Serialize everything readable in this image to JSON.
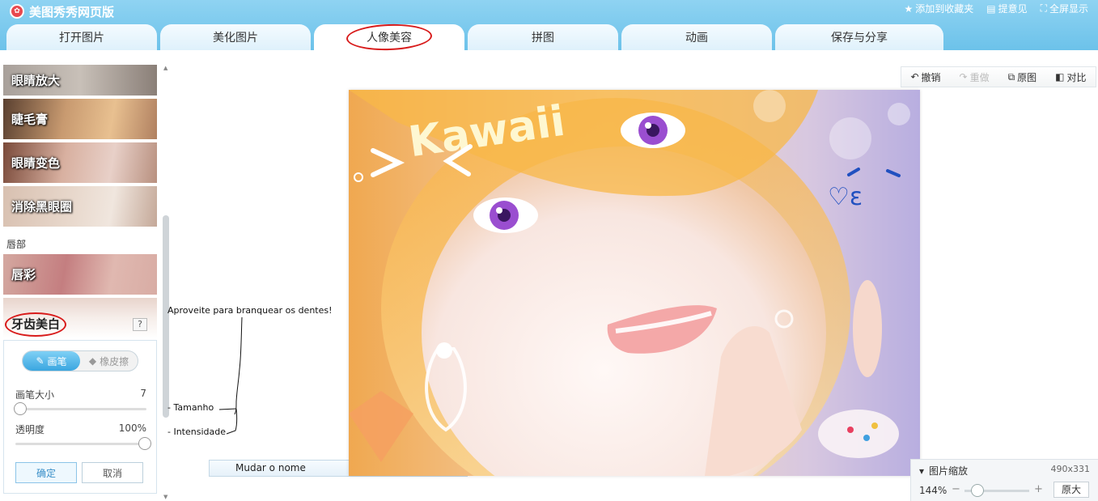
{
  "app": {
    "title": "美图秀秀网页版",
    "top_actions": [
      {
        "label": "添加到收藏夹",
        "icon": "star-icon"
      },
      {
        "label": "提意见",
        "icon": "comment-icon"
      },
      {
        "label": "全屏显示",
        "icon": "fullscreen-icon"
      }
    ]
  },
  "tabs": [
    {
      "label": "打开图片"
    },
    {
      "label": "美化图片"
    },
    {
      "label": "人像美容",
      "active": true
    },
    {
      "label": "拼图"
    },
    {
      "label": "动画"
    },
    {
      "label": "保存与分享"
    }
  ],
  "left_panel": {
    "thumbs": {
      "eye_enlarge": "眼睛放大",
      "mascara": "睫毛膏",
      "eye_color": "眼睛变色",
      "dark_circle": "消除黑眼圈",
      "lip_color": "唇彩",
      "teeth": "牙齿美白"
    },
    "section_lips": "唇部",
    "help": "?",
    "tool": {
      "brush": "画笔",
      "eraser": "橡皮擦",
      "size_label": "画笔大小",
      "size_value": "7",
      "opacity_label": "透明度",
      "opacity_value": "100%",
      "ok": "确定",
      "cancel": "取消"
    }
  },
  "annotations": {
    "teeth_note": "Aproveite para branquear os dentes!",
    "size_note": "- Tamanho",
    "intensity_note": "- Intensidade",
    "rename": "Mudar o nome"
  },
  "edit_toolbar": {
    "undo": "撤销",
    "redo": "重做",
    "original": "原图",
    "compare": "对比"
  },
  "photo": {
    "overlay_text": "Kawaii",
    "heart_text": "♡ε"
  },
  "zoom": {
    "title": "图片缩放",
    "dims": "490x331",
    "value": "144%",
    "minus": "−",
    "plus": "+",
    "original": "原大"
  }
}
